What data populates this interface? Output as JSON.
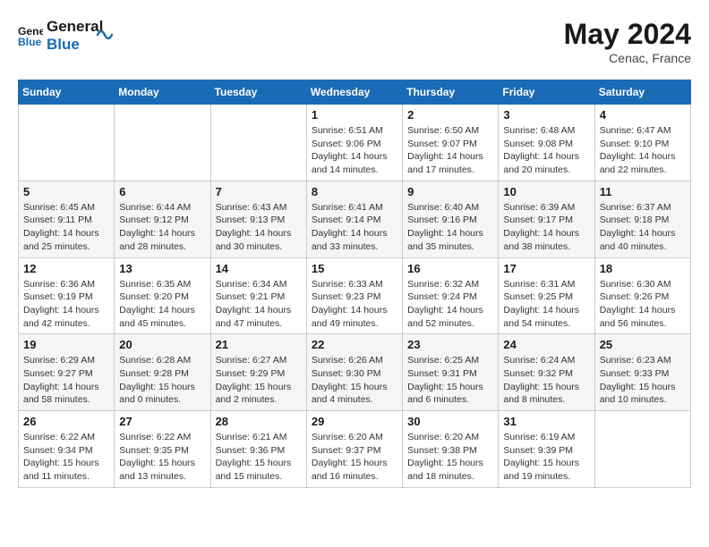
{
  "header": {
    "logo_line1": "General",
    "logo_line2": "Blue",
    "month": "May 2024",
    "location": "Cenac, France"
  },
  "weekdays": [
    "Sunday",
    "Monday",
    "Tuesday",
    "Wednesday",
    "Thursday",
    "Friday",
    "Saturday"
  ],
  "weeks": [
    [
      {
        "day": "",
        "detail": ""
      },
      {
        "day": "",
        "detail": ""
      },
      {
        "day": "",
        "detail": ""
      },
      {
        "day": "1",
        "detail": "Sunrise: 6:51 AM\nSunset: 9:06 PM\nDaylight: 14 hours\nand 14 minutes."
      },
      {
        "day": "2",
        "detail": "Sunrise: 6:50 AM\nSunset: 9:07 PM\nDaylight: 14 hours\nand 17 minutes."
      },
      {
        "day": "3",
        "detail": "Sunrise: 6:48 AM\nSunset: 9:08 PM\nDaylight: 14 hours\nand 20 minutes."
      },
      {
        "day": "4",
        "detail": "Sunrise: 6:47 AM\nSunset: 9:10 PM\nDaylight: 14 hours\nand 22 minutes."
      }
    ],
    [
      {
        "day": "5",
        "detail": "Sunrise: 6:45 AM\nSunset: 9:11 PM\nDaylight: 14 hours\nand 25 minutes."
      },
      {
        "day": "6",
        "detail": "Sunrise: 6:44 AM\nSunset: 9:12 PM\nDaylight: 14 hours\nand 28 minutes."
      },
      {
        "day": "7",
        "detail": "Sunrise: 6:43 AM\nSunset: 9:13 PM\nDaylight: 14 hours\nand 30 minutes."
      },
      {
        "day": "8",
        "detail": "Sunrise: 6:41 AM\nSunset: 9:14 PM\nDaylight: 14 hours\nand 33 minutes."
      },
      {
        "day": "9",
        "detail": "Sunrise: 6:40 AM\nSunset: 9:16 PM\nDaylight: 14 hours\nand 35 minutes."
      },
      {
        "day": "10",
        "detail": "Sunrise: 6:39 AM\nSunset: 9:17 PM\nDaylight: 14 hours\nand 38 minutes."
      },
      {
        "day": "11",
        "detail": "Sunrise: 6:37 AM\nSunset: 9:18 PM\nDaylight: 14 hours\nand 40 minutes."
      }
    ],
    [
      {
        "day": "12",
        "detail": "Sunrise: 6:36 AM\nSunset: 9:19 PM\nDaylight: 14 hours\nand 42 minutes."
      },
      {
        "day": "13",
        "detail": "Sunrise: 6:35 AM\nSunset: 9:20 PM\nDaylight: 14 hours\nand 45 minutes."
      },
      {
        "day": "14",
        "detail": "Sunrise: 6:34 AM\nSunset: 9:21 PM\nDaylight: 14 hours\nand 47 minutes."
      },
      {
        "day": "15",
        "detail": "Sunrise: 6:33 AM\nSunset: 9:23 PM\nDaylight: 14 hours\nand 49 minutes."
      },
      {
        "day": "16",
        "detail": "Sunrise: 6:32 AM\nSunset: 9:24 PM\nDaylight: 14 hours\nand 52 minutes."
      },
      {
        "day": "17",
        "detail": "Sunrise: 6:31 AM\nSunset: 9:25 PM\nDaylight: 14 hours\nand 54 minutes."
      },
      {
        "day": "18",
        "detail": "Sunrise: 6:30 AM\nSunset: 9:26 PM\nDaylight: 14 hours\nand 56 minutes."
      }
    ],
    [
      {
        "day": "19",
        "detail": "Sunrise: 6:29 AM\nSunset: 9:27 PM\nDaylight: 14 hours\nand 58 minutes."
      },
      {
        "day": "20",
        "detail": "Sunrise: 6:28 AM\nSunset: 9:28 PM\nDaylight: 15 hours\nand 0 minutes."
      },
      {
        "day": "21",
        "detail": "Sunrise: 6:27 AM\nSunset: 9:29 PM\nDaylight: 15 hours\nand 2 minutes."
      },
      {
        "day": "22",
        "detail": "Sunrise: 6:26 AM\nSunset: 9:30 PM\nDaylight: 15 hours\nand 4 minutes."
      },
      {
        "day": "23",
        "detail": "Sunrise: 6:25 AM\nSunset: 9:31 PM\nDaylight: 15 hours\nand 6 minutes."
      },
      {
        "day": "24",
        "detail": "Sunrise: 6:24 AM\nSunset: 9:32 PM\nDaylight: 15 hours\nand 8 minutes."
      },
      {
        "day": "25",
        "detail": "Sunrise: 6:23 AM\nSunset: 9:33 PM\nDaylight: 15 hours\nand 10 minutes."
      }
    ],
    [
      {
        "day": "26",
        "detail": "Sunrise: 6:22 AM\nSunset: 9:34 PM\nDaylight: 15 hours\nand 11 minutes."
      },
      {
        "day": "27",
        "detail": "Sunrise: 6:22 AM\nSunset: 9:35 PM\nDaylight: 15 hours\nand 13 minutes."
      },
      {
        "day": "28",
        "detail": "Sunrise: 6:21 AM\nSunset: 9:36 PM\nDaylight: 15 hours\nand 15 minutes."
      },
      {
        "day": "29",
        "detail": "Sunrise: 6:20 AM\nSunset: 9:37 PM\nDaylight: 15 hours\nand 16 minutes."
      },
      {
        "day": "30",
        "detail": "Sunrise: 6:20 AM\nSunset: 9:38 PM\nDaylight: 15 hours\nand 18 minutes."
      },
      {
        "day": "31",
        "detail": "Sunrise: 6:19 AM\nSunset: 9:39 PM\nDaylight: 15 hours\nand 19 minutes."
      },
      {
        "day": "",
        "detail": ""
      }
    ]
  ]
}
